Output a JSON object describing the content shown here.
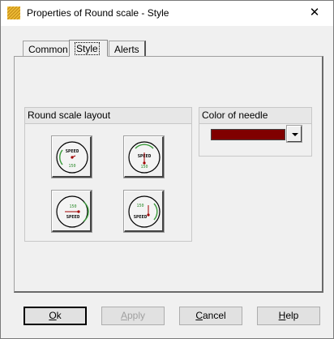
{
  "window": {
    "title": "Properties of Round scale  - Style",
    "close_glyph": "✕",
    "icon": "folder-grid-icon"
  },
  "tabs": [
    {
      "label": "Common",
      "active": false
    },
    {
      "label": "Style",
      "active": true
    },
    {
      "label": "Alerts",
      "active": false
    }
  ],
  "layout_group": {
    "title": "Round scale layout",
    "options": [
      {
        "name": "layout-needle-down-right",
        "top_label": "SPEED",
        "bottom_label": "150"
      },
      {
        "name": "layout-needle-up",
        "top_label": "SPEED",
        "bottom_label": "150"
      },
      {
        "name": "layout-needle-left",
        "top_label": "150",
        "bottom_label": "SPEED"
      },
      {
        "name": "layout-needle-vertical",
        "top_label": "150",
        "bottom_label": "SPEED"
      }
    ]
  },
  "needle_group": {
    "title": "Color of needle",
    "selected_color": "#800000"
  },
  "buttons": {
    "ok": {
      "prefix": "",
      "mnemonic": "O",
      "rest": "k"
    },
    "apply": {
      "prefix": "",
      "mnemonic": "A",
      "rest": "pply"
    },
    "cancel": {
      "prefix": "",
      "mnemonic": "C",
      "rest": "ancel"
    },
    "help": {
      "prefix": "",
      "mnemonic": "H",
      "rest": "elp"
    }
  },
  "colors": {
    "gauge_arc": "#3a9a3a",
    "needle": "#a00000",
    "label_green": "#2a8a2a"
  }
}
